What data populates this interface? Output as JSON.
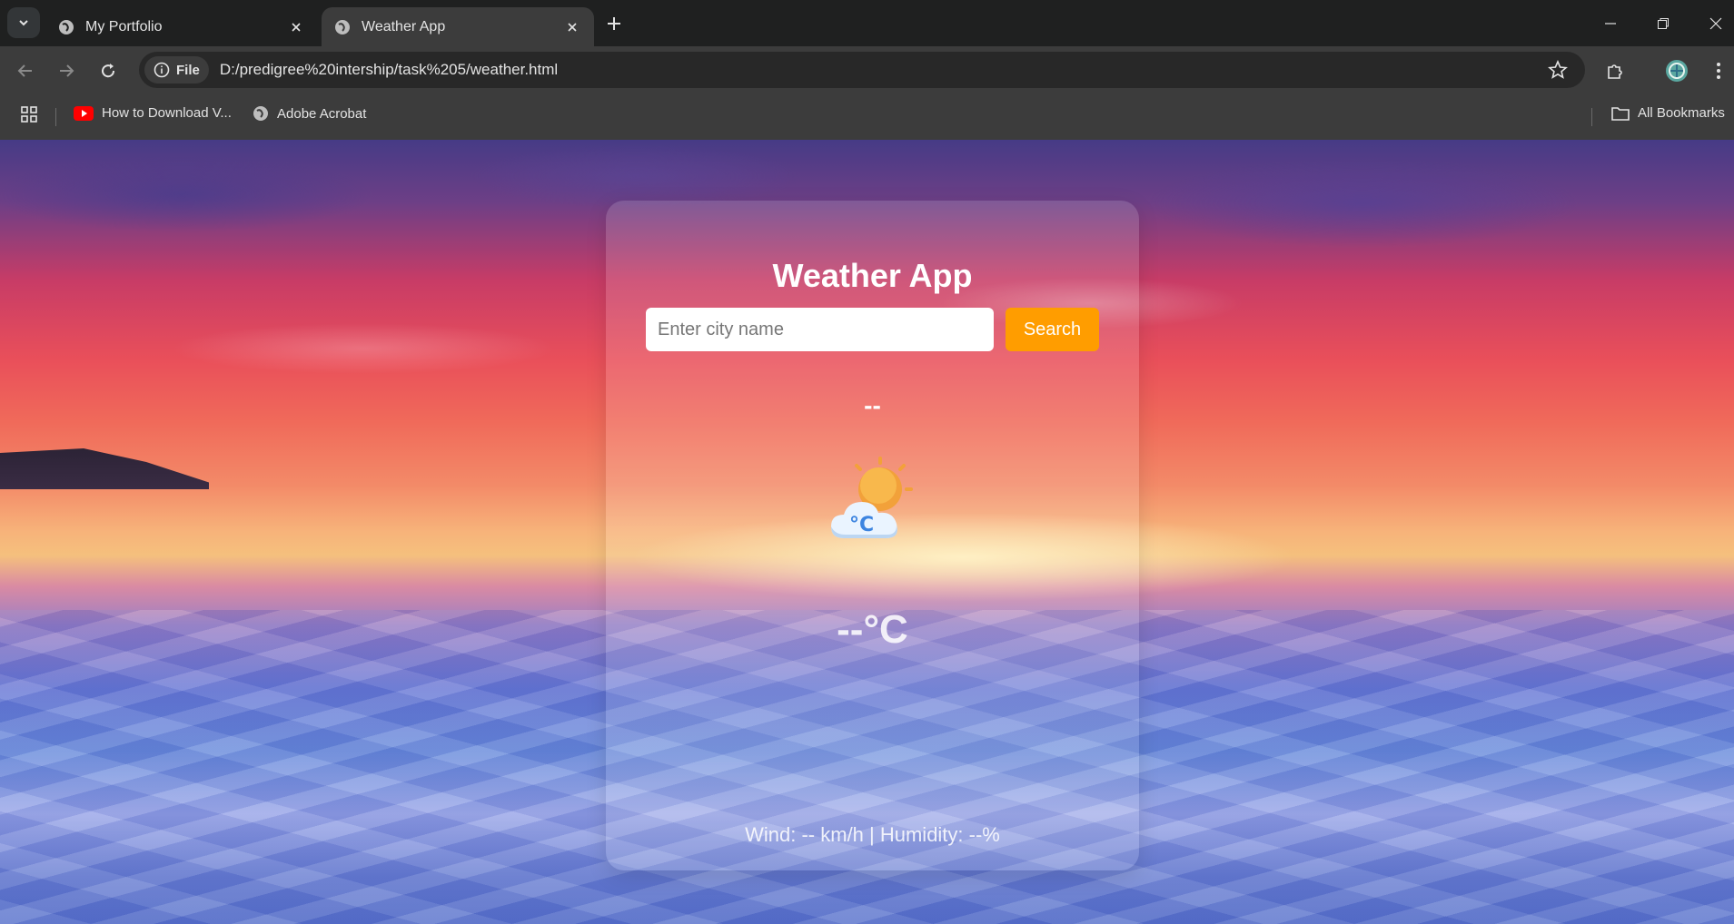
{
  "browser": {
    "tabs": [
      {
        "title": "My Portfolio",
        "active": false
      },
      {
        "title": "Weather App",
        "active": true
      }
    ],
    "address": {
      "security_chip": "File",
      "url": "D:/predigree%20intership/task%205/weather.html"
    },
    "bookmarks": [
      {
        "label": "How to Download V...",
        "icon": "youtube-icon"
      },
      {
        "label": "Adobe Acrobat",
        "icon": "globe-icon"
      }
    ],
    "all_bookmarks_label": "All Bookmarks"
  },
  "app": {
    "title": "Weather App",
    "search": {
      "placeholder": "Enter city name",
      "value": "",
      "button_label": "Search"
    },
    "city": "--",
    "icon": "sun-behind-cloud-celsius-icon",
    "temperature": "--°C",
    "details": "Wind: -- km/h | Humidity: --%"
  },
  "colors": {
    "search_button": "#ff9d00",
    "chrome_dark": "#1f2020",
    "chrome_toolbar": "#3c3c3c"
  }
}
